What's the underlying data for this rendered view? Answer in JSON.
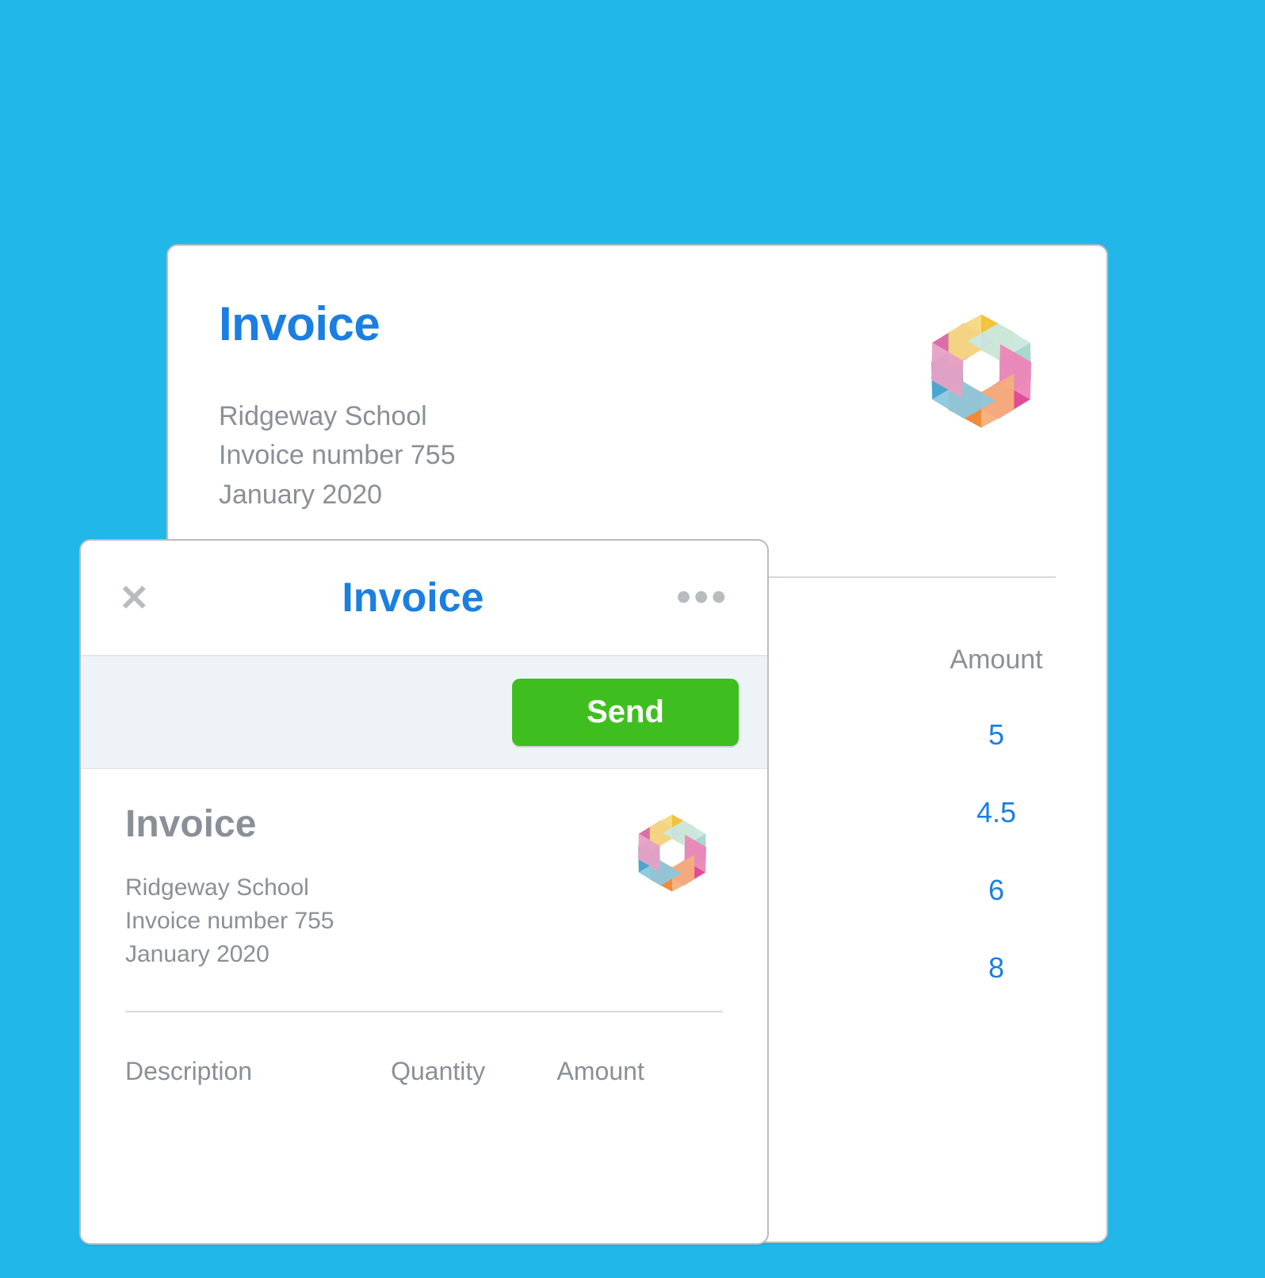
{
  "back": {
    "title": "Invoice",
    "customer": "Ridgeway School",
    "invoice_number_label": "Invoice number 755",
    "date": "January 2020",
    "columns": {
      "amount": "Amount"
    },
    "rows": [
      {
        "amount": "5"
      },
      {
        "amount": "4.5"
      },
      {
        "amount": "6"
      },
      {
        "amount": "8"
      }
    ]
  },
  "front": {
    "header_title": "Invoice",
    "send_label": "Send",
    "subtitle": "Invoice",
    "customer": "Ridgeway School",
    "invoice_number_label": "Invoice number 755",
    "date": "January 2020",
    "columns": {
      "description": "Description",
      "quantity": "Quantity",
      "amount": "Amount"
    }
  }
}
